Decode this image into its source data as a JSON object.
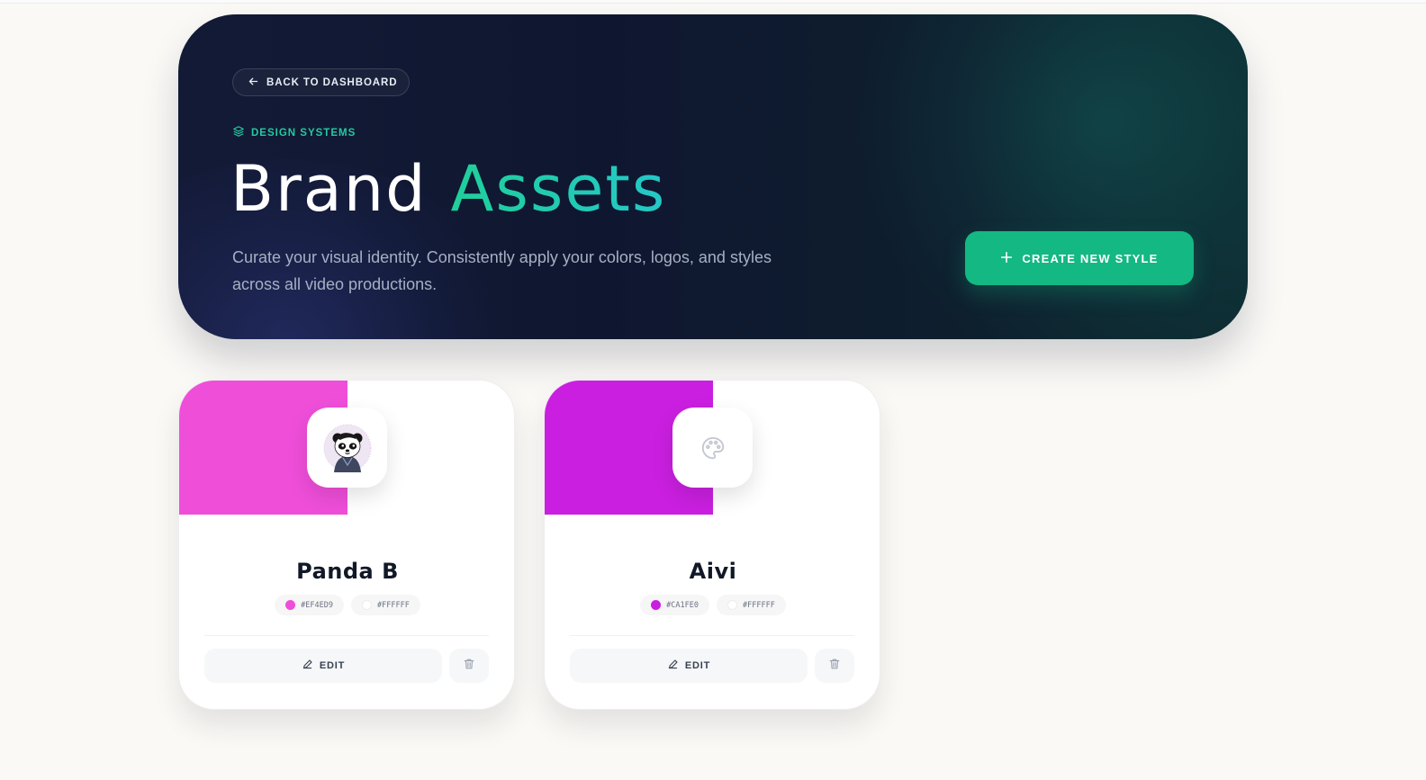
{
  "hero": {
    "back_label": "BACK TO DASHBOARD",
    "eyebrow": "DESIGN SYSTEMS",
    "title_main": "Brand",
    "title_accent": "Assets",
    "subtitle": "Curate your visual identity. Consistently apply your colors, logos, and styles across all video productions.",
    "create_label": "CREATE NEW STYLE",
    "colors": {
      "primary": "#13b883",
      "accent_start": "#1fcf9a",
      "accent_end": "#25c7c8",
      "bg_dark": "#0f1730"
    }
  },
  "styles": [
    {
      "name": "Panda B",
      "primary_color": "#EF4ED9",
      "secondary_color": "#FFFFFF",
      "primary_hex": "#EF4ED9",
      "secondary_hex": "#FFFFFF",
      "logo": "panda-avatar",
      "edit_label": "EDIT"
    },
    {
      "name": "Aivi",
      "primary_color": "#CA1FE0",
      "secondary_color": "#FFFFFF",
      "primary_hex": "#CA1FE0",
      "secondary_hex": "#FFFFFF",
      "logo": "palette-icon",
      "edit_label": "EDIT"
    }
  ],
  "icons": {
    "back": "arrow-left-icon",
    "eyebrow": "layers-icon",
    "create": "plus-icon",
    "edit": "pencil-icon",
    "delete": "trash-icon"
  }
}
